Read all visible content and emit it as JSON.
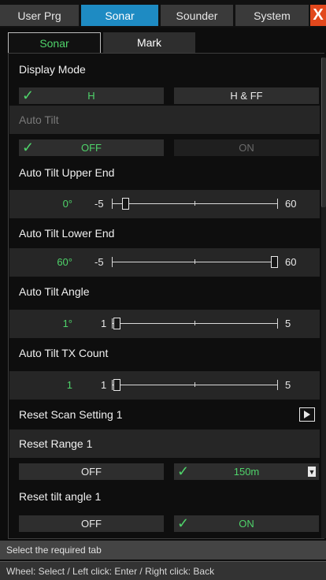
{
  "top_tabs": [
    {
      "label": "User Prg"
    },
    {
      "label": "Sonar"
    },
    {
      "label": "Sounder"
    },
    {
      "label": "System"
    }
  ],
  "close_label": "X",
  "sub_tabs": [
    {
      "label": "Sonar"
    },
    {
      "label": "Mark"
    }
  ],
  "settings": {
    "display_mode": {
      "label": "Display Mode",
      "opt1": "H",
      "opt2": "H & FF",
      "check": "✓"
    },
    "auto_tilt": {
      "label": "Auto Tilt",
      "opt1": "OFF",
      "opt2": "ON",
      "check": "✓"
    },
    "upper_end": {
      "label": "Auto Tilt Upper End",
      "value": "0°",
      "min": "-5",
      "max": "60",
      "level": 0.08
    },
    "lower_end": {
      "label": "Auto Tilt Lower End",
      "value": "60°",
      "min": "-5",
      "max": "60",
      "level": 1.0
    },
    "angle": {
      "label": "Auto Tilt Angle",
      "value": "1°",
      "min": "1",
      "max": "5",
      "level": 0.0
    },
    "tx_count": {
      "label": "Auto Tilt TX Count",
      "value": "1",
      "min": "1",
      "max": "5",
      "level": 0.0
    },
    "reset_scan": {
      "label": "Reset Scan Setting 1"
    },
    "reset_range": {
      "label": "Reset Range 1",
      "opt1": "OFF",
      "opt2": "150m",
      "check": "✓"
    },
    "reset_tilt": {
      "label": "Reset tilt angle 1",
      "opt1": "OFF",
      "opt2": "ON",
      "check": "✓"
    }
  },
  "status": {
    "hint": "Select the required tab",
    "help": "Wheel: Select / Left click: Enter / Right click: Back"
  },
  "colors": {
    "accent": "#1e8bc3",
    "on": "#4fd36a",
    "close": "#e2481d"
  }
}
